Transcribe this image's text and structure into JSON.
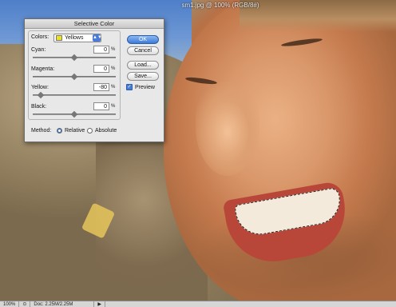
{
  "document": {
    "title": "sm1.jpg @ 100% (RGB/8#)"
  },
  "dialog": {
    "title": "Selective Color",
    "colors_label": "Colors:",
    "colors_value": "Yellows",
    "swatch_color": "#f0e21a",
    "sliders": [
      {
        "label": "Cyan:",
        "value": "0",
        "unit": "%",
        "level": 0.5
      },
      {
        "label": "Magenta:",
        "value": "0",
        "unit": "%",
        "level": 0.5
      },
      {
        "label": "Yellow:",
        "value": "-80",
        "unit": "%",
        "level": 0.1
      },
      {
        "label": "Black:",
        "value": "0",
        "unit": "%",
        "level": 0.5
      }
    ],
    "buttons": {
      "ok": "OK",
      "cancel": "Cancel",
      "load": "Load...",
      "save": "Save..."
    },
    "preview_label": "Preview",
    "method": {
      "label": "Method:",
      "relative": "Relative",
      "absolute": "Absolute",
      "selected": "Relative"
    }
  },
  "statusbar": {
    "zoom": "100%",
    "doc": "Doc: 2.25M/2.25M"
  },
  "colors": {
    "accent": "#3d79d8",
    "dialog_bg": "#e8e8e8"
  }
}
